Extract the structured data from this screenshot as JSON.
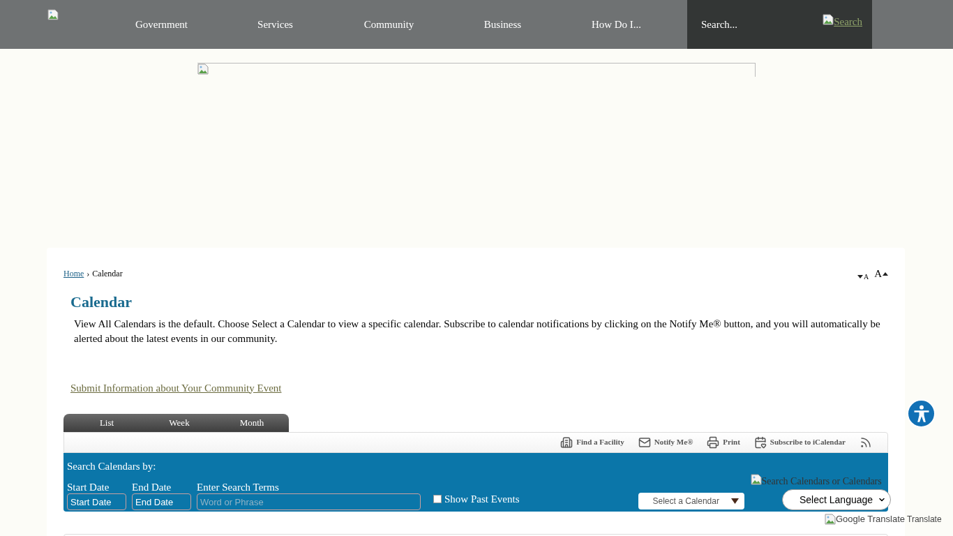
{
  "nav": {
    "items": [
      "Government",
      "Services",
      "Community",
      "Business",
      "How Do I..."
    ],
    "search": {
      "placeholder": "Search..."
    },
    "search_button": "Search"
  },
  "breadcrumb": {
    "home": "Home",
    "separator": "›",
    "current": "Calendar"
  },
  "text_size": {
    "decrease": "A",
    "increase": "A"
  },
  "page": {
    "title": "Calendar",
    "intro": "View All Calendars is the default. Choose Select a Calendar to view a specific calendar. Subscribe to calendar notifications by clicking on the Notify Me® button, and you will automatically be alerted about the latest events in our community.",
    "submit_link": "Submit Information about Your Community Event"
  },
  "tabs": [
    "List",
    "Week",
    "Month"
  ],
  "toolbar": [
    {
      "kind": "facility",
      "label": "Find a Facility"
    },
    {
      "kind": "notify",
      "label": "Notify Me®"
    },
    {
      "kind": "print",
      "label": "Print"
    },
    {
      "kind": "ical",
      "label": "Subscribe to iCalendar"
    },
    {
      "kind": "rss"
    }
  ],
  "search_panel": {
    "heading": "Search Calendars by:",
    "start": {
      "label": "Start Date",
      "value": "Start Date"
    },
    "end": {
      "label": "End Date",
      "value": "End Date"
    },
    "terms": {
      "label": "Enter Search Terms",
      "placeholder": "Word or Phrase"
    },
    "past_events": {
      "label": "Show Past Events",
      "checked": false
    },
    "calendar_select": "Select a Calendar",
    "search_image_alt": "Search Calendars or Calendars"
  },
  "translate": {
    "select": "Select Language",
    "alt": "Google Translate",
    "label": "Translate"
  }
}
